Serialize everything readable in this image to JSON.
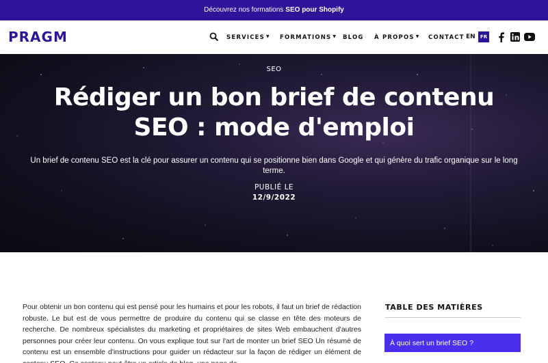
{
  "promo": {
    "prefix": "Découvrez nos formations",
    "highlight": "SEO pour Shopify"
  },
  "header": {
    "logo": "PRAGM",
    "menu": [
      {
        "label": "SERVICES",
        "has_dropdown": true
      },
      {
        "label": "FORMATIONS",
        "has_dropdown": true
      },
      {
        "label": "BLOG",
        "has_dropdown": false
      },
      {
        "label": "À PROPOS",
        "has_dropdown": true
      },
      {
        "label": "CONTACT",
        "has_dropdown": false
      }
    ],
    "lang_en": "EN",
    "lang_fr": "FR",
    "social_icons": [
      "facebook-icon",
      "linkedin-icon",
      "youtube-icon"
    ]
  },
  "hero": {
    "category": "SEO",
    "title": "Rédiger un bon brief de contenu SEO : mode d'emploi",
    "subtitle": "Un brief de contenu SEO est la clé pour assurer un contenu qui se positionne bien dans Google et qui génère du trafic organique sur le long terme.",
    "published_label": "PUBLIÉ LE",
    "published_date": "12/9/2022"
  },
  "article": {
    "intro": "Pour obtenir un bon contenu qui est pensé pour les humains et pour les robots, il faut un brief de rédaction robuste. Le but est de vous permettre de produire du contenu qui se classe en tête des moteurs de recherche. De nombreux spécialistes du marketing et propriétaires de sites Web embauchent d'autres personnes pour créer leur contenu. On vous explique tout sur l'art de monter un brief SEO Un résumé de contenu est un ensemble d'instructions pour guider un rédacteur sur la façon de rédiger un élément de contenu SEO. Ce contenu peut être un article de blog, une page de"
  },
  "toc": {
    "title": "TABLE DES MATIÈRES",
    "items": [
      "À quoi sert un brief SEO ?"
    ]
  },
  "colors": {
    "brand": "#2d1498",
    "accent": "#4a30ee"
  }
}
